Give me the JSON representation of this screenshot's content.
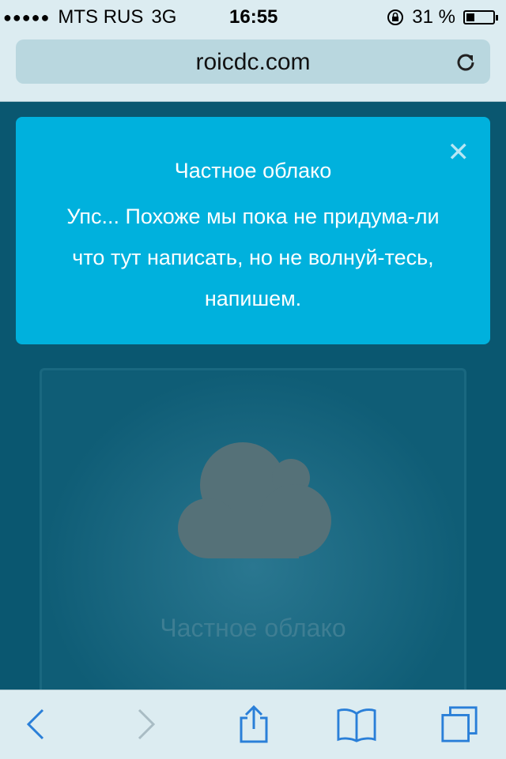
{
  "status_bar": {
    "signal": "●●●●●",
    "carrier": "MTS RUS",
    "network": "3G",
    "time": "16:55",
    "battery": "31 %",
    "battery_level": 0.31
  },
  "browser": {
    "url": "roicdc.com"
  },
  "notice": {
    "close": "✕",
    "title": "Частное облако",
    "text": "Упс... Похоже мы пока не придума-ли что тут написать, но не волнуй-тесь, напишем."
  },
  "card": {
    "label": "Частное облако"
  },
  "colors": {
    "page_bg": "#0a5770",
    "notice_bg": "#00b1dd",
    "ios_blue": "#2a7fd8"
  }
}
